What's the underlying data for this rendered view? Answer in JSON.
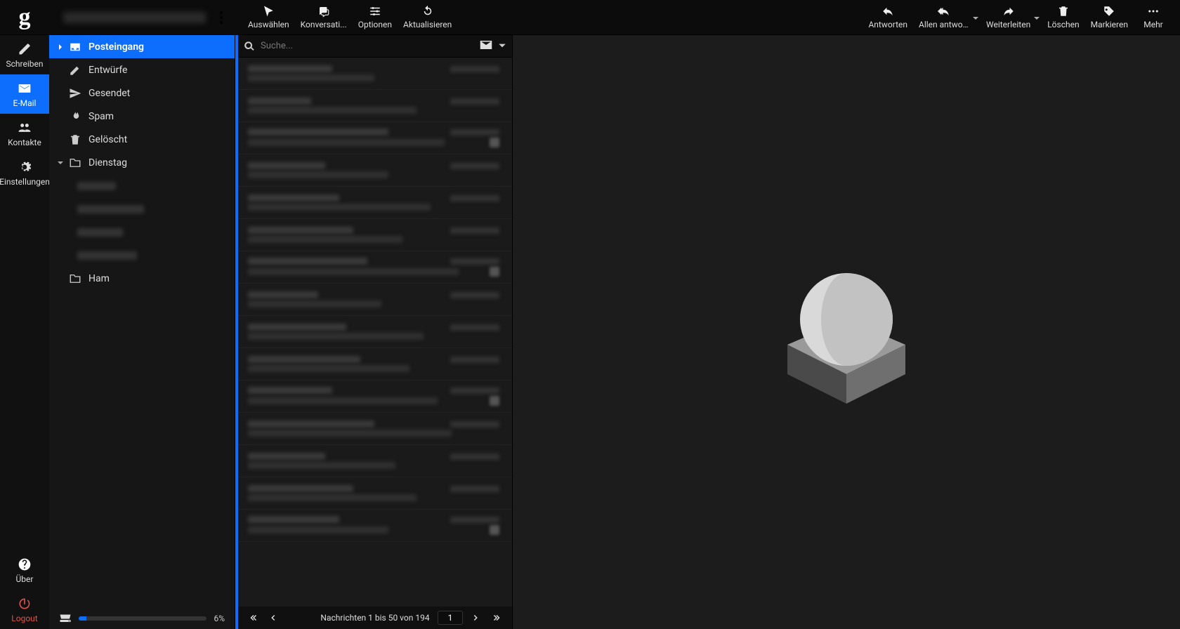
{
  "header": {
    "logo_text": "g",
    "toolbar_left": {
      "select": "Auswählen",
      "conversations": "Konversati...",
      "options": "Optionen",
      "refresh": "Aktualisieren"
    },
    "toolbar_right": {
      "reply": "Antworten",
      "reply_all": "Allen antwo...",
      "forward": "Weiterleiten",
      "delete": "Löschen",
      "mark": "Markieren",
      "more": "Mehr"
    }
  },
  "rail": {
    "compose": "Schreiben",
    "mail": "E-Mail",
    "contacts": "Kontakte",
    "settings": "Einstellungen",
    "about": "Über",
    "logout": "Logout"
  },
  "folders": {
    "inbox": "Posteingang",
    "drafts": "Entwürfe",
    "sent": "Gesendet",
    "spam": "Spam",
    "trash": "Gelöscht",
    "tuesday": "Dienstag",
    "ham": "Ham"
  },
  "quota": {
    "percent_label": "6%",
    "percent_value": 6
  },
  "search": {
    "placeholder": "Suche..."
  },
  "pager": {
    "summary": "Nachrichten 1 bis 50 von 194",
    "page": "1"
  }
}
